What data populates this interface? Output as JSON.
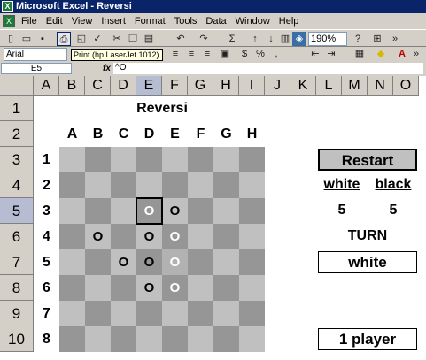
{
  "window": {
    "title": "Microsoft Excel - Reversi"
  },
  "menu": [
    "File",
    "Edit",
    "View",
    "Insert",
    "Format",
    "Tools",
    "Data",
    "Window",
    "Help"
  ],
  "toolbar": {
    "zoom": "190%",
    "tooltip": "Print (hp LaserJet 1012)"
  },
  "format_bar": {
    "font": "Arial"
  },
  "formula_bar": {
    "name_box": "E5",
    "fx": "fx",
    "formula": "^O"
  },
  "sheet": {
    "columns": [
      "A",
      "B",
      "C",
      "D",
      "E",
      "F",
      "G",
      "H",
      "I",
      "J",
      "K",
      "L",
      "M",
      "N",
      "O"
    ],
    "rows": [
      "1",
      "2",
      "3",
      "4",
      "5",
      "6",
      "7",
      "8",
      "9",
      "10"
    ],
    "selected_cell": "E5"
  },
  "game": {
    "title": "Reversi",
    "board_cols": [
      "A",
      "B",
      "C",
      "D",
      "E",
      "F",
      "G",
      "H"
    ],
    "board_rows": [
      "1",
      "2",
      "3",
      "4",
      "5",
      "6",
      "7",
      "8"
    ],
    "pieces": [
      {
        "row": 3,
        "col": 4,
        "color": "white",
        "glyph": "O"
      },
      {
        "row": 3,
        "col": 5,
        "color": "black",
        "glyph": "O"
      },
      {
        "row": 4,
        "col": 2,
        "color": "black",
        "glyph": "O"
      },
      {
        "row": 4,
        "col": 4,
        "color": "black",
        "glyph": "O"
      },
      {
        "row": 4,
        "col": 5,
        "color": "white",
        "glyph": "O"
      },
      {
        "row": 5,
        "col": 3,
        "color": "black",
        "glyph": "O"
      },
      {
        "row": 5,
        "col": 4,
        "color": "black",
        "glyph": "O"
      },
      {
        "row": 5,
        "col": 5,
        "color": "white",
        "glyph": "O"
      },
      {
        "row": 6,
        "col": 4,
        "color": "black",
        "glyph": "O"
      },
      {
        "row": 6,
        "col": 5,
        "color": "white",
        "glyph": "O"
      }
    ],
    "restart_label": "Restart",
    "white_label": "white",
    "black_label": "black",
    "white_score": "5",
    "black_score": "5",
    "turn_label": "TURN",
    "turn_value": "white",
    "mode_label": "1 player",
    "colors": {
      "light_square": "#c0c0c0",
      "dark_square": "#969696",
      "hint_square": "#b2b2b2",
      "white_piece": "#ffffff",
      "black_piece": "#000000"
    }
  }
}
